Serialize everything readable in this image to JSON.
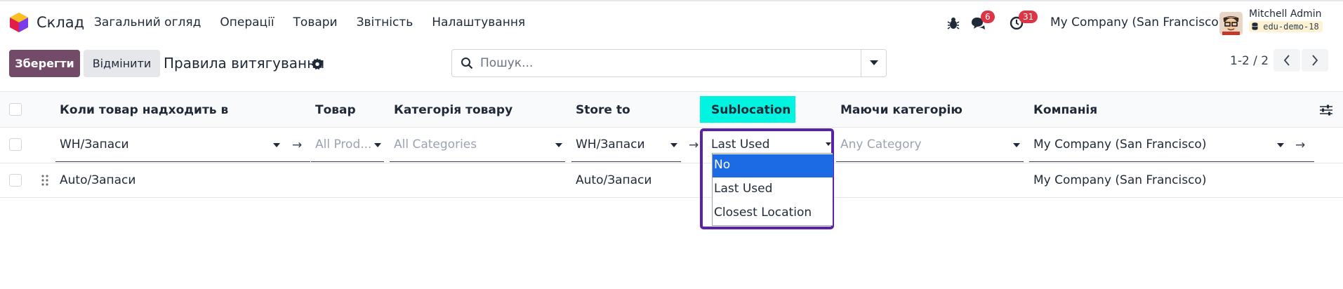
{
  "app": {
    "name": "Склад",
    "logo_icon": "odoo-app-logo-icon"
  },
  "nav": {
    "items": [
      "Загальний огляд",
      "Операції",
      "Товари",
      "Звітність",
      "Налаштування"
    ]
  },
  "systray": {
    "debug_icon": "bug-icon",
    "messages_count": "6",
    "activities_count": "31",
    "company": "My Company (San Francisco)",
    "user_name": "Mitchell Admin",
    "database": "edu-demo-18"
  },
  "control": {
    "save_label": "Зберегти",
    "discard_label": "Відмінити",
    "title": "Правила витягування",
    "search_placeholder": "Пошук...",
    "pager": "1-2 / 2"
  },
  "table": {
    "columns": [
      "Коли товар надходить в",
      "Товар",
      "Категорія товару",
      "Store to",
      "Sublocation",
      "Маючи категорію",
      "Компанія"
    ],
    "edit_row": {
      "location": "WH/Запаси",
      "product": "All Prod...",
      "category": "All Categories",
      "store_to": "WH/Запаси",
      "sublocation": "Last Used",
      "having_category": "Any Category",
      "company": "My Company (San Francisco)"
    },
    "rows": [
      {
        "location": "Auto/Запаси",
        "store_to": "Auto/Запаси",
        "company": "My Company (San Francisco)"
      }
    ]
  },
  "dropdown": {
    "options": [
      "No",
      "Last Used",
      "Closest Location"
    ],
    "highlighted": "No"
  },
  "colors": {
    "brand": "#714b67",
    "highlight": "#00f5e1",
    "focus": "#5b21a6",
    "option_selected": "#1c6ae4",
    "badge": "#dc3545"
  }
}
